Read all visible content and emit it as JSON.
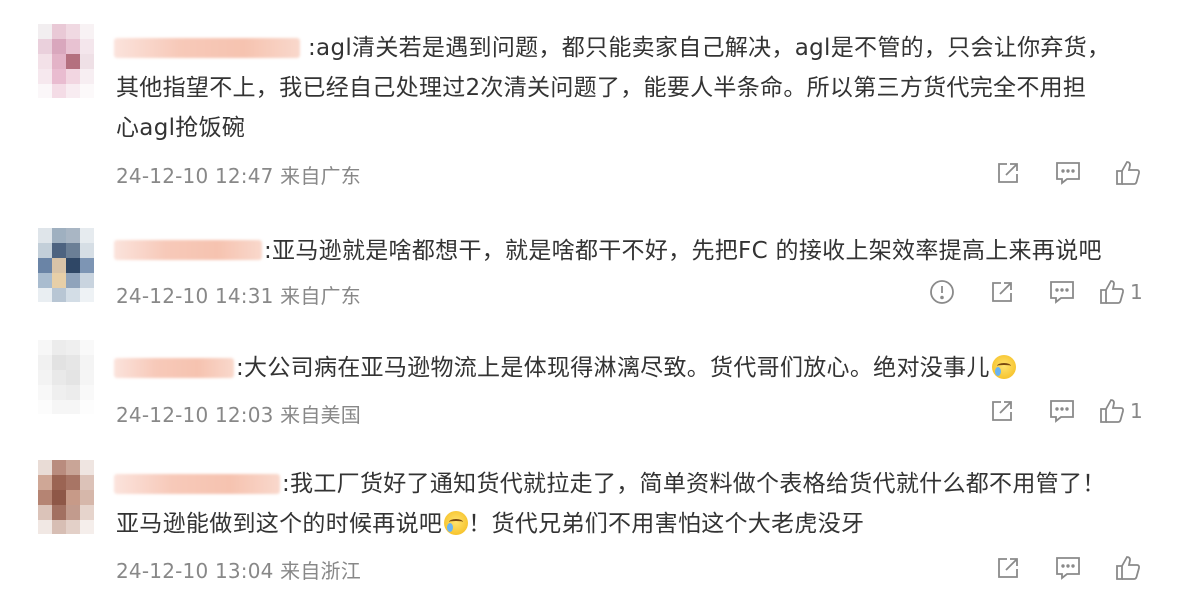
{
  "comments": [
    {
      "text_line1": ":agl清关若是遇到问题，都只能卖家自己解决，agl是不管的，只会让你弃货，",
      "text_line2": "其他指望不上，我已经自己处理过2次清关问题了，能要人半条命。所以第三方货代完全不用担",
      "text_line3": "心agl抢饭碗",
      "time": "24-12-10 12:47",
      "location": "来自广东",
      "like_count": ""
    },
    {
      "text_line1": ":亚马逊就是啥都想干，就是啥都干不好，先把FC 的接收上架效率提高上来再说吧",
      "time": "24-12-10 14:31",
      "location": "来自广东",
      "like_count": "1"
    },
    {
      "text_line1": ":大公司病在亚马逊物流上是体现得淋漓尽致。货代哥们放心。绝对没事儿",
      "time": "24-12-10 12:03",
      "location": "来自美国",
      "like_count": "1"
    },
    {
      "text_line1": ":我工厂货好了通知货代就拉走了，简单资料做个表格给货代就什么都不用管了！",
      "text_line2a": "亚马逊能做到这个的时候再说吧",
      "text_line2b": "！货代兄弟们不用害怕这个大老虎没牙",
      "time": "24-12-10 13:04",
      "location": "来自浙江",
      "like_count": ""
    }
  ],
  "icons": [
    "report-icon",
    "forward-icon",
    "reply-icon",
    "like-icon"
  ],
  "colors": {
    "text": "#333333",
    "meta": "#888888",
    "icon": "#8a8a8a",
    "name_blur": "#f6c3b0"
  }
}
